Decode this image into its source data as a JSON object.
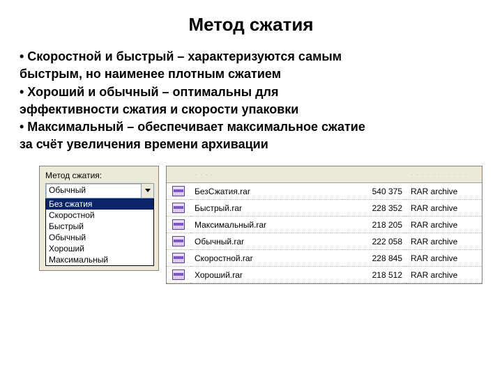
{
  "title": "Метод сжатия",
  "bullets": [
    "• Скоростной и быстрый – характеризуются самым",
    "  быстрым, но наименее плотным сжатием",
    "• Хороший и обычный – оптимальны для",
    "  эффективности сжатия и скорости упаковки",
    "• Максимальный – обеспечивает максимальное сжатие",
    "  за счёт увеличения времени архивации"
  ],
  "dropdown": {
    "label": "Метод сжатия:",
    "selected": "Обычный",
    "options": [
      "Без сжатия",
      "Скоростной",
      "Быстрый",
      "Обычный",
      "Хороший",
      "Максимальный"
    ],
    "highlighted_index": 0
  },
  "files": {
    "header_blur_left": "· · · ·",
    "header_blur_right": "· · · · · · · · · · ·",
    "rows": [
      {
        "name": "БезСжатия.rar",
        "size": "540 375",
        "type": "RAR archive"
      },
      {
        "name": "Быстрый.rar",
        "size": "228 352",
        "type": "RAR archive"
      },
      {
        "name": "Максимальный.rar",
        "size": "218 205",
        "type": "RAR archive"
      },
      {
        "name": "Обычный.rar",
        "size": "222 058",
        "type": "RAR archive"
      },
      {
        "name": "Скоростной.rar",
        "size": "228 845",
        "type": "RAR archive"
      },
      {
        "name": "Хороший.rar",
        "size": "218 512",
        "type": "RAR archive"
      }
    ]
  }
}
